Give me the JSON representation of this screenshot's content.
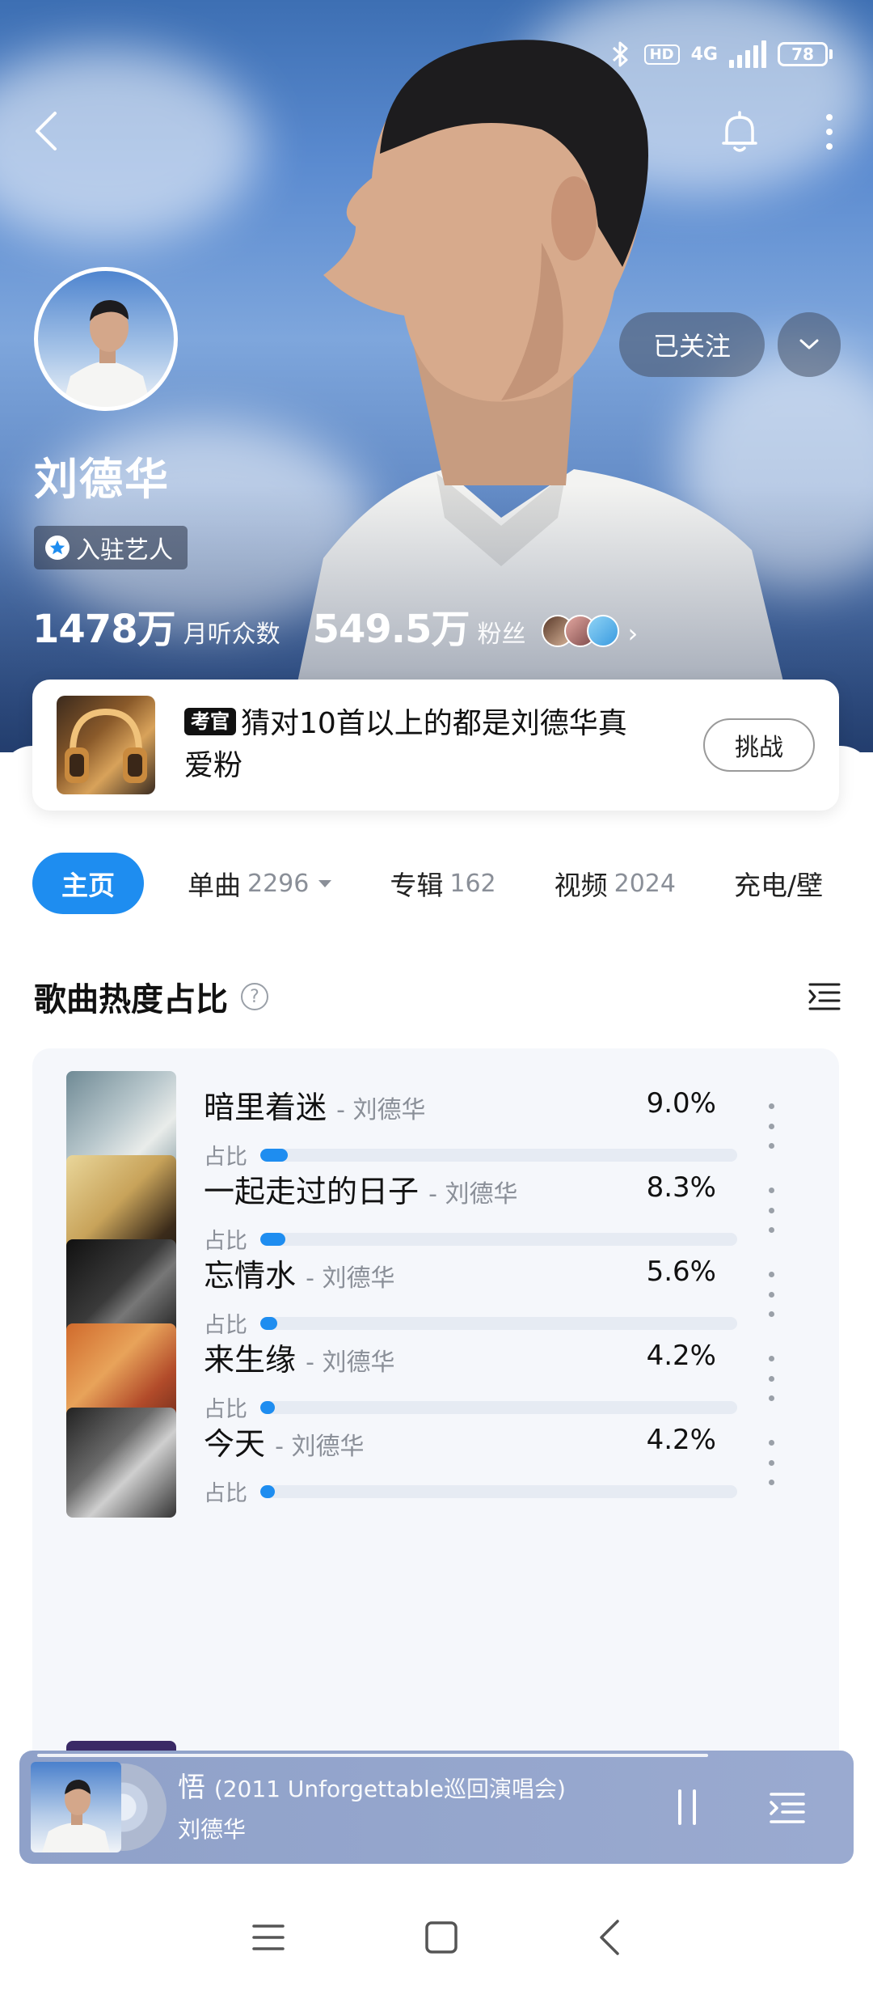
{
  "status_bar": {
    "network": "4G",
    "hd": "HD",
    "battery": "78"
  },
  "artist": {
    "name": "刘德华",
    "badge": "入驻艺人",
    "listeners_value": "1478万",
    "listeners_label": "月听众数",
    "fans_value": "549.5万",
    "fans_label": "粉丝",
    "follow_label": "已关注"
  },
  "quiz": {
    "tag": "考官",
    "text": "猜对10首以上的都是刘德华真爱粉",
    "button": "挑战"
  },
  "tabs": [
    {
      "label": "主页",
      "count": ""
    },
    {
      "label": "单曲",
      "count": "2296"
    },
    {
      "label": "专辑",
      "count": "162"
    },
    {
      "label": "视频",
      "count": "2024"
    },
    {
      "label": "充电/壁",
      "count": ""
    }
  ],
  "section": {
    "title": "歌曲热度占比",
    "help": "?"
  },
  "songs": [
    {
      "title": "暗里着迷",
      "artist": "- 刘德华",
      "percent": "9.0%",
      "share_label": "占比",
      "share": 0.09
    },
    {
      "title": "一起走过的日子",
      "artist": "- 刘德华",
      "percent": "8.3%",
      "share_label": "占比",
      "share": 0.083
    },
    {
      "title": "忘情水",
      "artist": "- 刘德华",
      "percent": "5.6%",
      "share_label": "占比",
      "share": 0.056
    },
    {
      "title": "来生缘",
      "artist": "- 刘德华",
      "percent": "4.2%",
      "share_label": "占比",
      "share": 0.042
    },
    {
      "title": "今天",
      "artist": "- 刘德华",
      "percent": "4.2%",
      "share_label": "占比",
      "share": 0.042
    }
  ],
  "now_playing": {
    "title": "悟",
    "subtitle": "(2011 Unforgettable巡回演唱会)",
    "artist": "刘德华"
  },
  "colors": {
    "accent": "#1e8df0",
    "track": "#e6ebf3",
    "muted_text": "#8a8f98"
  },
  "icons": {
    "back": "back-arrow-icon",
    "bell": "bell-icon",
    "more": "more-vertical-icon",
    "list": "list-icon",
    "pause": "pause-icon",
    "queue": "playlist-icon"
  }
}
